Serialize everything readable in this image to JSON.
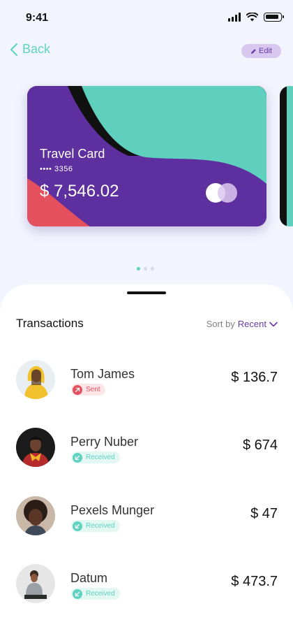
{
  "status_bar": {
    "time": "9:41"
  },
  "nav": {
    "back_label": "Back",
    "edit_label": "Edit"
  },
  "card": {
    "name": "Travel Card",
    "number_masked": "•••• 3356",
    "balance": "$ 7,546.02",
    "colors": {
      "base": "#5e2f9e",
      "accent_teal": "#5ed0bd",
      "accent_red": "#e5505f",
      "stripe": "#111111"
    }
  },
  "carousel": {
    "page_count": 3,
    "active_index": 0
  },
  "transactions": {
    "title": "Transactions",
    "sort_prefix": "Sort by",
    "sort_value": "Recent",
    "items": [
      {
        "name": "Tom James",
        "status": "Sent",
        "amount": "$ 136.7"
      },
      {
        "name": "Perry Nuber",
        "status": "Received",
        "amount": "$ 674"
      },
      {
        "name": "Pexels Munger",
        "status": "Received",
        "amount": "$ 47"
      },
      {
        "name": "Datum",
        "status": "Received",
        "amount": "$ 473.7"
      }
    ]
  },
  "colors": {
    "teal": "#5fd2c0",
    "purple": "#6a3aa6",
    "red": "#e5505f",
    "background": "#f2f5fd"
  }
}
